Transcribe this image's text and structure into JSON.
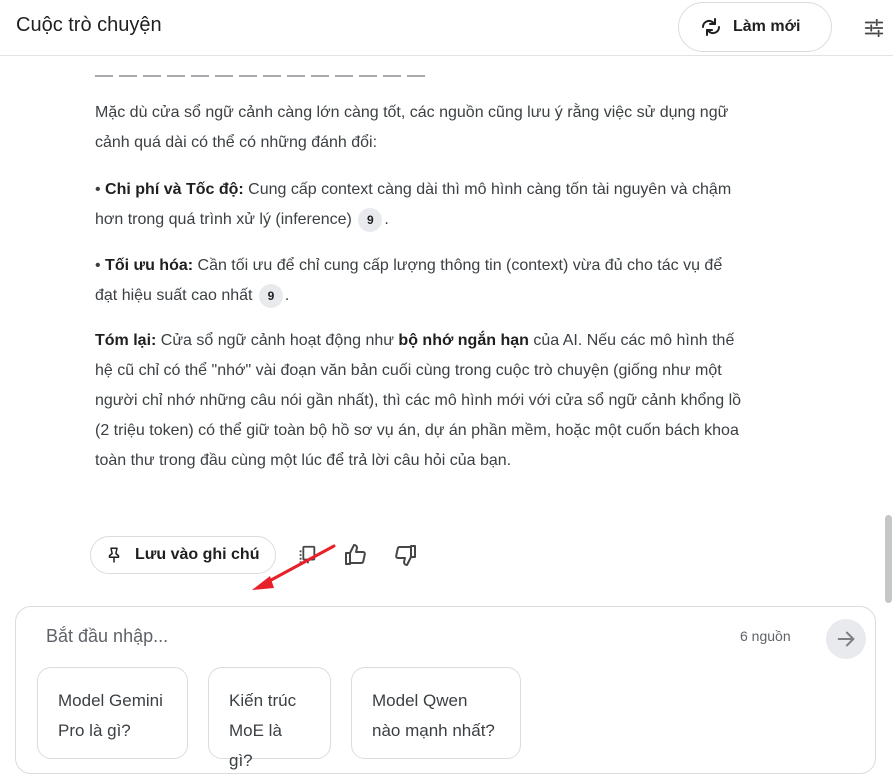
{
  "header": {
    "title": "Cuộc trò chuyện",
    "refresh_label": "Làm mới"
  },
  "message": {
    "p1": "Mặc dù cửa sổ ngữ cảnh càng lớn càng tốt, các nguồn cũng lưu ý rằng việc sử dụng ngữ cảnh quá dài có thể có những đánh đổi:",
    "bullet1": {
      "prefix": "• ",
      "bold": "Chi phí và Tốc độ:",
      "text": " Cung cấp context càng dài thì mô hình càng tốn tài nguyên và chậm hơn trong quá trình xử lý (inference) ",
      "cite": "9",
      "end": "."
    },
    "bullet2": {
      "prefix": "• ",
      "bold": "Tối ưu hóa:",
      "text": " Cần tối ưu để chỉ cung cấp lượng thông tin (context) vừa đủ cho tác vụ để đạt hiệu suất cao nhất ",
      "cite": "9",
      "end": "."
    },
    "summary": {
      "bold1": "Tóm lại:",
      "text1": " Cửa sổ ngữ cảnh hoạt động như ",
      "bold2": "bộ nhớ ngắn hạn",
      "text2": " của AI. Nếu các mô hình thế hệ cũ chỉ có thể \"nhớ\" vài đoạn văn bản cuối cùng trong cuộc trò chuyện (giống như một người chỉ nhớ những câu nói gần nhất), thì các mô hình mới với cửa sổ ngữ cảnh khổng lồ (2 triệu token) có thể giữ toàn bộ hồ sơ vụ án, dự án phần mềm, hoặc một cuốn bách khoa toàn thư trong đầu cùng một lúc để trả lời câu hỏi của bạn."
    }
  },
  "actions": {
    "save_note_label": "Lưu vào ghi chú"
  },
  "composer": {
    "placeholder": "Bắt đầu nhập...",
    "sources": "6 nguồn",
    "suggestions": [
      {
        "line1": "Model Gemini",
        "line2": "Pro là gì?"
      },
      {
        "line1": "Kiến trúc",
        "line2": "MoE là gì?"
      },
      {
        "line1": "Model Qwen",
        "line2": "nào mạnh nhất?"
      }
    ]
  },
  "colors": {
    "arrow": "#e8202a",
    "border": "#dadce0",
    "text": "#1f1f1f"
  }
}
